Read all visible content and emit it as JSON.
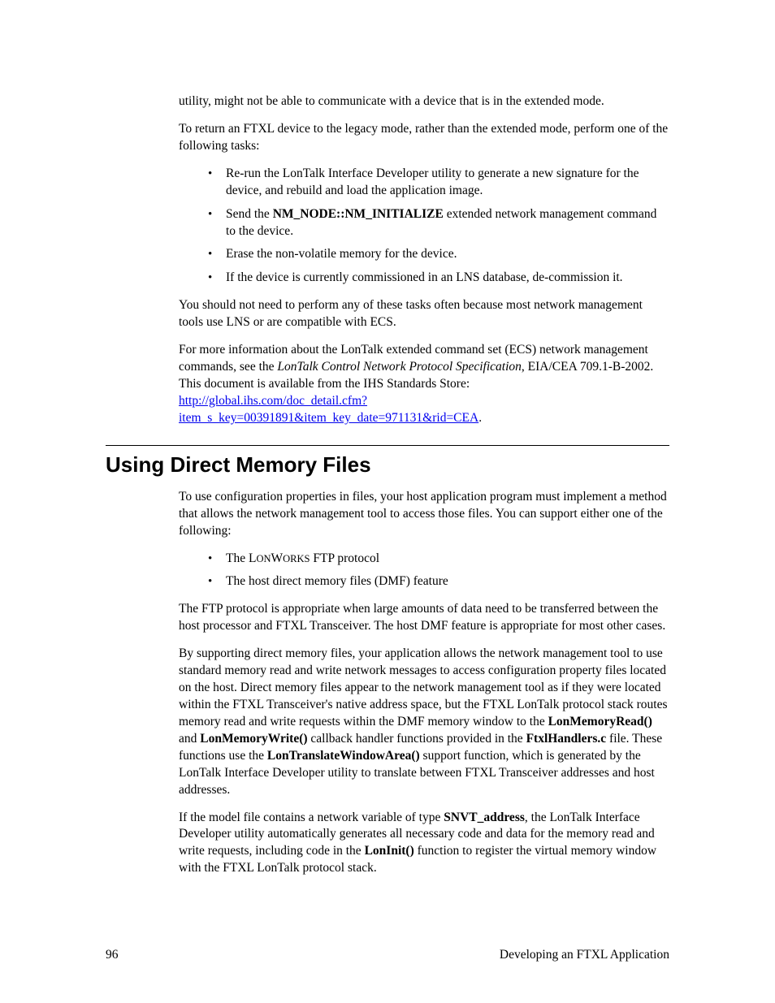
{
  "p1": "utility, might not be able to communicate with a device that is in the extended mode.",
  "p2": "To return an FTXL device to the legacy mode, rather than the extended mode, perform one of the following tasks:",
  "list1": {
    "item1": "Re-run the LonTalk Interface Developer utility to generate a new signature for the device, and rebuild and load the application image.",
    "item2_a": "Send the ",
    "item2_bold": "NM_NODE::NM_INITIALIZE",
    "item2_b": " extended network management command to the device.",
    "item3": "Erase the non-volatile memory for the device.",
    "item4": "If the device is currently commissioned in an LNS database, de-commission it."
  },
  "p3": "You should not need to perform any of these tasks often because most network management tools use LNS or are compatible with ECS.",
  "p4_a": "For more information about the LonTalk extended command set (ECS) network management commands, see the ",
  "p4_italic": "LonTalk Control Network Protocol Specification",
  "p4_b": ", EIA/CEA 709.1-B-2002.  This document is available from the IHS Standards Store:",
  "link": "http://global.ihs.com/doc_detail.cfm?item_s_key=00391891&item_key_date=971131&rid=CEA",
  "p4_c": ".",
  "heading": "Using Direct Memory Files",
  "p5": "To use configuration properties in files, your host application program must implement a method that allows the network management tool to access those files.  You can support either one of the following:",
  "list2": {
    "item1_a": "The L",
    "item1_sc": "ON",
    "item1_b": "W",
    "item1_sc2": "ORKS",
    "item1_c": " FTP protocol",
    "item2": "The host direct memory files (DMF) feature"
  },
  "p6": "The FTP protocol is appropriate when large amounts of data need to be transferred between the host processor and FTXL Transceiver.  The host DMF feature is appropriate for most other cases.",
  "p7_a": "By supporting direct memory files, your application allows the network management tool to use standard memory read and write network messages to access configuration property files located on the host.  Direct memory files appear to the network management tool as if they were located within the FTXL Transceiver's native address space, but the FTXL LonTalk protocol stack routes memory read and write requests within the DMF memory window to the ",
  "p7_b1": "LonMemoryRead()",
  "p7_c": " and ",
  "p7_b2": "LonMemoryWrite()",
  "p7_d": " callback handler functions provided in the ",
  "p7_b3": "FtxlHandlers.c",
  "p7_e": " file.  These functions use the ",
  "p7_b4": "LonTranslateWindowArea()",
  "p7_f": " support function, which is generated by the LonTalk Interface Developer utility to translate between FTXL Transceiver addresses and host addresses.",
  "p8_a": "If the model file contains a network variable of type ",
  "p8_b1": "SNVT_address",
  "p8_b": ", the LonTalk Interface Developer utility automatically generates all necessary code and data for the memory read and write requests, including code in the ",
  "p8_b2": "LonInit()",
  "p8_c": " function to register the virtual memory window with the FTXL LonTalk protocol stack.",
  "footer": {
    "page": "96",
    "title": "Developing an FTXL Application"
  }
}
